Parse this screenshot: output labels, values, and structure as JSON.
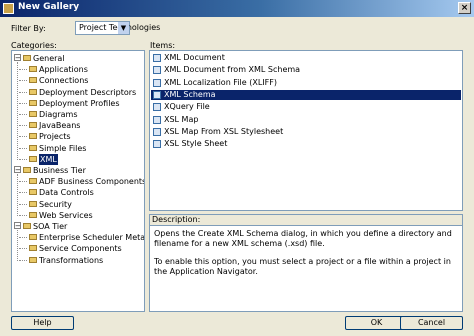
{
  "window": {
    "title": "New Gallery",
    "close_glyph": "×"
  },
  "filter": {
    "label": "Filter By:",
    "selected": "Project Technologies"
  },
  "categories": {
    "label": "Categories:",
    "tree": [
      {
        "label": "General",
        "level": 0,
        "expanded": true
      },
      {
        "label": "Applications",
        "level": 1
      },
      {
        "label": "Connections",
        "level": 1
      },
      {
        "label": "Deployment Descriptors",
        "level": 1
      },
      {
        "label": "Deployment Profiles",
        "level": 1
      },
      {
        "label": "Diagrams",
        "level": 1
      },
      {
        "label": "JavaBeans",
        "level": 1
      },
      {
        "label": "Projects",
        "level": 1
      },
      {
        "label": "Simple Files",
        "level": 1
      },
      {
        "label": "XML",
        "level": 1,
        "selected": true
      },
      {
        "label": "Business Tier",
        "level": 0,
        "expanded": true
      },
      {
        "label": "ADF Business Components",
        "level": 1
      },
      {
        "label": "Data Controls",
        "level": 1
      },
      {
        "label": "Security",
        "level": 1
      },
      {
        "label": "Web Services",
        "level": 1
      },
      {
        "label": "SOA Tier",
        "level": 0,
        "expanded": true
      },
      {
        "label": "Enterprise Scheduler Metadata",
        "level": 1
      },
      {
        "label": "Service Components",
        "level": 1
      },
      {
        "label": "Transformations",
        "level": 1
      }
    ]
  },
  "items": {
    "label": "Items:",
    "list": [
      {
        "label": "XML Document",
        "icon": "xml-document-icon"
      },
      {
        "label": "XML Document from XML Schema",
        "icon": "xml-document-icon"
      },
      {
        "label": "XML Localization File (XLIFF)",
        "icon": "xml-document-icon"
      },
      {
        "label": "XML Schema",
        "icon": "xml-schema-icon",
        "selected": true
      },
      {
        "label": "XQuery File",
        "icon": "xquery-icon"
      },
      {
        "label": "XSL Map",
        "icon": "xsl-map-icon"
      },
      {
        "label": "XSL Map From XSL Stylesheet",
        "icon": "xsl-map-icon"
      },
      {
        "label": "XSL Style Sheet",
        "icon": "xsl-stylesheet-icon"
      }
    ]
  },
  "description": {
    "label": "Description:",
    "p1": "Opens the Create XML Schema dialog, in which you define a directory and filename for a new XML schema (.xsd) file.",
    "p2": "To enable this option, you must select a project or a file within a project in the Application Navigator."
  },
  "buttons": {
    "help": "Help",
    "ok": "OK",
    "cancel": "Cancel"
  },
  "colors": {
    "selection": "#0a246a",
    "dialog_bg": "#ece9d8",
    "border": "#7f9db9"
  }
}
